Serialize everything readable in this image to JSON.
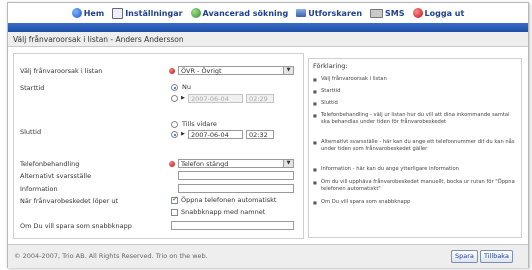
{
  "nav": {
    "items": [
      {
        "label": "Hem",
        "icon": "home-icon"
      },
      {
        "label": "Inställningar",
        "icon": "settings-icon"
      },
      {
        "label": "Avancerad sökning",
        "icon": "search-icon"
      },
      {
        "label": "Utforskaren",
        "icon": "explorer-icon"
      },
      {
        "label": "SMS",
        "icon": "sms-icon"
      },
      {
        "label": "Logga ut",
        "icon": "logout-icon"
      }
    ],
    "accent": "#1d4fa8"
  },
  "page_title": "Välj frånvaroorsak i listan - Anders Andersson",
  "form": {
    "reason_label": "Välj frånvaroorsak i listan",
    "reason_value": "ÖVR - Övrigt",
    "start_label": "Starttid",
    "start_now": "Nu",
    "start_date": "2007-06-04",
    "start_time": "02:29",
    "end_label": "Sluttid",
    "end_until": "Tills vidare",
    "end_date": "2007-06-04",
    "end_time": "02:32",
    "phone_label": "Telefonbehandling",
    "phone_value": "Telefon stängd",
    "alt_label": "Alternativt svarsställe",
    "info_label": "Information",
    "expires_label": "När frånvarobeskedet löper ut",
    "open_phone_label": "Öppna telefonen automatiskt",
    "quick_label": "Snabbknapp med namnet",
    "save_quick_label": "Om Du vill spara som snabbknapp"
  },
  "explanation": {
    "title": "Förklaring:",
    "items": [
      "Välj frånvaroorsak i listan",
      "Starttid",
      "Sluttid",
      "Telefonbehandling - välj ur listan hur du vill att dina inkommande samtal ska behandlas under tiden för frånvarobeskedet",
      "Alternativt svarsställe - här kan du ange ett telefonnummer dit du kan nås under tiden som frånvarobeskedet gäller",
      "Information - här kan du ange ytterligare information",
      "Om du vill upphäva frånvarobeskedet manuellt, bocka ur rutan för \"Öppna telefonen automatiskt\"",
      "Om Du vill spara som snabbknapp"
    ]
  },
  "footer": {
    "copyright": "© 2004-2007, Trio AB. All Rights Reserved.   Trio on the web.",
    "save_label": "Spara",
    "back_label": "Tillbaka"
  }
}
